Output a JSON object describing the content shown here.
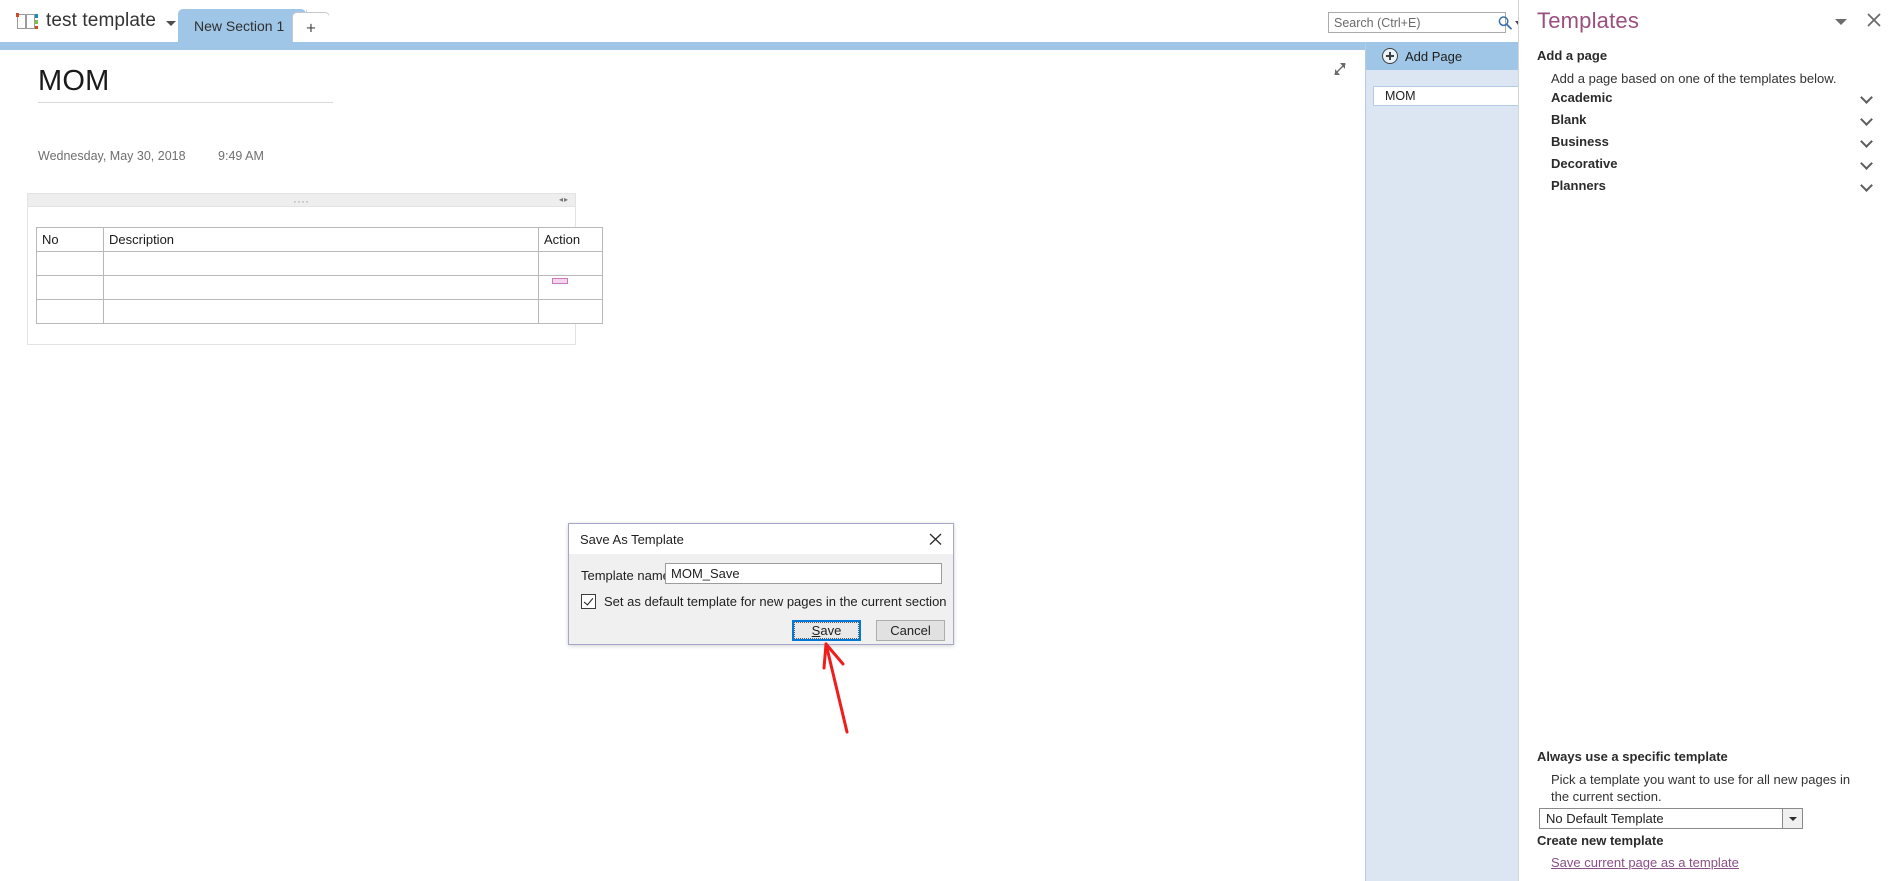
{
  "window": {
    "notebook_name": "test template",
    "notebook_icon": "notebook-icon",
    "notebook_dropdown_icon": "caret-down-icon"
  },
  "tabs": {
    "section_label": "New Section 1",
    "add_section_label": "+"
  },
  "search": {
    "placeholder": "Search (Ctrl+E)",
    "value": "",
    "icon": "search-icon",
    "dropdown_icon": "caret-down-icon"
  },
  "page": {
    "title": "MOM",
    "date": "Wednesday, May 30, 2018",
    "time": "9:49 AM",
    "expand_icon": "expand-arrows-icon",
    "note_handle_dots": "....",
    "note_handle_arrows": "◂▸",
    "table": {
      "headers": [
        "No",
        "Description",
        "Action"
      ],
      "rows": [
        [
          "",
          "",
          ""
        ],
        [
          "",
          "",
          ""
        ],
        [
          "",
          "",
          ""
        ]
      ]
    }
  },
  "page_list": {
    "add_page_label": "Add Page",
    "add_page_icon": "plus-circle-icon",
    "pages": [
      {
        "label": "MOM"
      }
    ]
  },
  "templates_pane": {
    "title": "Templates",
    "dropdown_icon": "caret-down-icon",
    "close_icon": "close-icon",
    "add_a_page_heading": "Add a page",
    "add_a_page_desc": "Add a page based on one of the templates below.",
    "categories": [
      {
        "label": "Academic",
        "chevron": "chevron-down-icon"
      },
      {
        "label": "Blank",
        "chevron": "chevron-down-icon"
      },
      {
        "label": "Business",
        "chevron": "chevron-down-icon"
      },
      {
        "label": "Decorative",
        "chevron": "chevron-down-icon"
      },
      {
        "label": "Planners",
        "chevron": "chevron-down-icon"
      }
    ],
    "always_use_heading": "Always use a specific template",
    "always_use_desc": "Pick a template you want to use for all new pages in the current section.",
    "default_template_value": "No Default Template",
    "create_new_heading": "Create new template",
    "save_current_link": "Save current page as a template"
  },
  "dialog": {
    "title": "Save As Template",
    "close_icon": "close-icon",
    "template_name_label": "Template name:",
    "template_name_value": "MOM_Save",
    "checkbox_label": "Set as default template for new pages in the current section",
    "checkbox_checked": true,
    "save_label": "Save",
    "cancel_label": "Cancel"
  },
  "annotation": {
    "arrow_color": "#f01d1d",
    "points_to": "save-button"
  },
  "colors": {
    "accent_blue": "#9fc6e7",
    "panel_blue": "#dce6f2",
    "templates_heading": "#9a4f7e",
    "link_purple": "#8a4f86",
    "focus_blue": "#0078d7"
  }
}
